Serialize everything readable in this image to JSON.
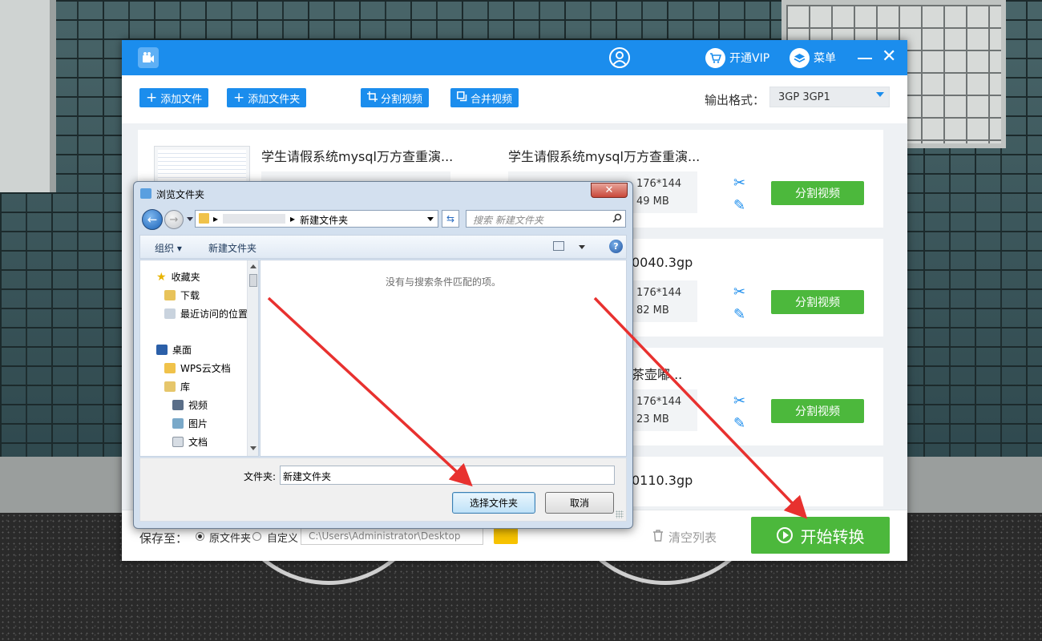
{
  "app": {
    "toolbar": {
      "add_file": "添加文件",
      "add_folder": "添加文件夹",
      "split_video": "分割视频",
      "merge_video": "合并视频",
      "format_label": "输出格式：",
      "format_value": "3GP  3GP1"
    },
    "titlebar": {
      "vip_label": "开通VIP",
      "menu_label": "菜单"
    },
    "files": [
      {
        "left_title": "学生请假系统mysql万方查重演...",
        "right_title": "学生请假系统mysql万方查重演...",
        "resolution": "176*144",
        "size": "49 MB",
        "action": "分割视频"
      },
      {
        "right_title": "0040.3gp",
        "resolution": "176*144",
        "size": "82 MB",
        "action": "分割视频"
      },
      {
        "right_title": "茶壶嘟...",
        "resolution": "176*144",
        "size": "23 MB",
        "action": "分割视频"
      },
      {
        "right_title": "0110.3gp"
      }
    ],
    "bottom": {
      "save_label": "保存至：",
      "option_original": "原文件夹",
      "option_custom": "自定义",
      "path": "C:\\Users\\Administrator\\Desktop",
      "clear_list": "清空列表",
      "start": "开始转换"
    }
  },
  "dialog": {
    "title": "浏览文件夹",
    "address_crumb": "新建文件夹",
    "search_placeholder": "搜索 新建文件夹",
    "organize": "组织 ▾",
    "new_folder": "新建文件夹",
    "empty_message": "没有与搜索条件匹配的项。",
    "nav": {
      "favorites": "收藏夹",
      "downloads": "下载",
      "recent": "最近访问的位置",
      "desktop": "桌面",
      "wps": "WPS云文档",
      "library": "库",
      "video": "视频",
      "pictures": "图片",
      "documents": "文档"
    },
    "folder_label": "文件夹:",
    "folder_value": "新建文件夹",
    "select_btn": "选择文件夹",
    "cancel_btn": "取消"
  },
  "colors": {
    "brand_blue": "#1b8ded",
    "action_green": "#4cb83c",
    "arrow_red": "#e8312f"
  }
}
